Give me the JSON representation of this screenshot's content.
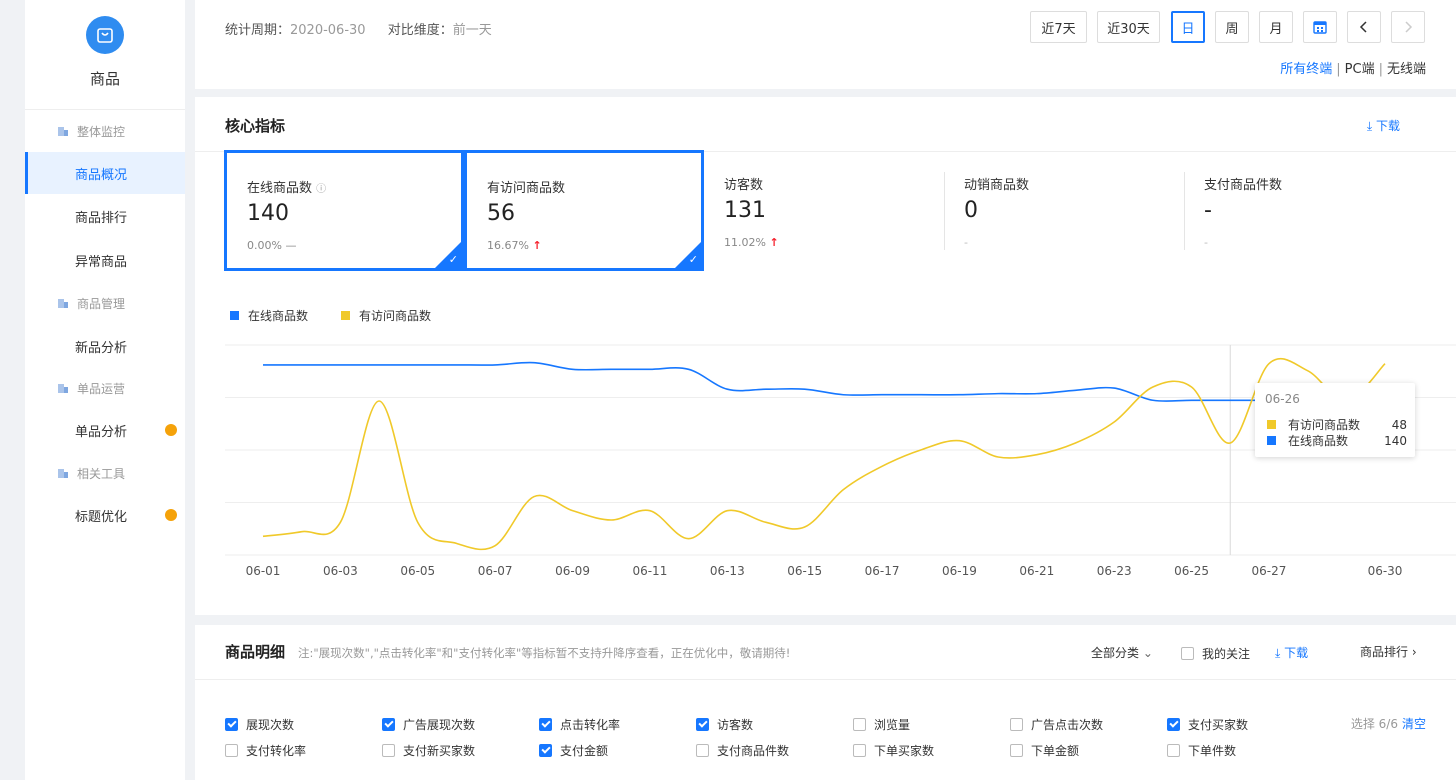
{
  "sidebar": {
    "title": "商品",
    "groups": [
      "整体监控",
      "商品管理",
      "单品运营",
      "相关工具"
    ],
    "items": [
      "商品概况",
      "商品排行",
      "异常商品",
      "新品分析",
      "单品分析",
      "标题优化"
    ]
  },
  "topbar": {
    "period_label": "统计周期：",
    "period_value": "2020-06-30",
    "compare_label": "对比维度：",
    "compare_value": "前一天",
    "buttons": [
      "近7天",
      "近30天",
      "日",
      "周",
      "月"
    ],
    "terminals": [
      "所有终端",
      "PC端",
      "无线端"
    ],
    "separator": "|"
  },
  "core": {
    "title": "核心指标",
    "download": "下载",
    "cards": [
      {
        "name": "在线商品数",
        "value": "140",
        "change": "0.00%",
        "trend": "—",
        "selected": true
      },
      {
        "name": "有访问商品数",
        "value": "56",
        "change": "16.67%",
        "trend": "↑",
        "selected": true
      },
      {
        "name": "访客数",
        "value": "131",
        "change": "11.02%",
        "trend": "↑",
        "selected": false
      },
      {
        "name": "动销商品数",
        "value": "0",
        "change": "-",
        "trend": "",
        "selected": false
      },
      {
        "name": "支付商品件数",
        "value": "-",
        "change": "-",
        "trend": "",
        "selected": false
      }
    ]
  },
  "chart_data": {
    "type": "line",
    "x": [
      "06-01",
      "06-02",
      "06-03",
      "06-04",
      "06-05",
      "06-06",
      "06-07",
      "06-08",
      "06-09",
      "06-10",
      "06-11",
      "06-12",
      "06-13",
      "06-14",
      "06-15",
      "06-16",
      "06-17",
      "06-18",
      "06-19",
      "06-20",
      "06-21",
      "06-22",
      "06-23",
      "06-24",
      "06-25",
      "06-26",
      "06-27",
      "06-28",
      "06-29",
      "06-30"
    ],
    "tick_labels": [
      "06-01",
      "06-03",
      "06-05",
      "06-07",
      "06-09",
      "06-11",
      "06-13",
      "06-15",
      "06-17",
      "06-19",
      "06-21",
      "06-23",
      "06-25",
      "06-27",
      "06-30"
    ],
    "series": [
      {
        "name": "在线商品数",
        "color": "#1677ff",
        "values": [
          172,
          172,
          172,
          172,
          172,
          172,
          172,
          174,
          168,
          168,
          168,
          168,
          150,
          150,
          150,
          145,
          145,
          145,
          145,
          146,
          146,
          149,
          151,
          140,
          140,
          140,
          140,
          140,
          140,
          140
        ]
      },
      {
        "name": "有访问商品数",
        "color": "#f0c92a",
        "values": [
          8,
          10,
          14,
          66,
          14,
          5,
          4,
          25,
          19,
          15,
          19,
          7,
          19,
          14,
          12,
          28,
          38,
          45,
          49,
          42,
          43,
          48,
          57,
          72,
          72,
          48,
          82,
          79,
          66,
          82
        ]
      }
    ],
    "tooltip": {
      "date": "06-26",
      "rows": [
        {
          "name": "有访问商品数",
          "value": "48"
        },
        {
          "name": "在线商品数",
          "value": "140"
        }
      ]
    }
  },
  "detail": {
    "title": "商品明细",
    "note": "注:\"展现次数\",\"点击转化率\"和\"支付转化率\"等指标暂不支持升降序查看，正在优化中，敬请期待!",
    "category": "全部分类",
    "my_follow": "我的关注",
    "download": "下载",
    "ranking": "商品排行",
    "options": [
      {
        "label": "展现次数",
        "checked": true
      },
      {
        "label": "广告展现次数",
        "checked": true
      },
      {
        "label": "点击转化率",
        "checked": true
      },
      {
        "label": "访客数",
        "checked": true
      },
      {
        "label": "浏览量",
        "checked": false
      },
      {
        "label": "广告点击次数",
        "checked": false
      },
      {
        "label": "支付买家数",
        "checked": true
      },
      {
        "label": "支付转化率",
        "checked": false
      },
      {
        "label": "支付新买家数",
        "checked": false
      },
      {
        "label": "支付金额",
        "checked": true
      },
      {
        "label": "支付商品件数",
        "checked": false
      },
      {
        "label": "下单买家数",
        "checked": false
      },
      {
        "label": "下单金额",
        "checked": false
      },
      {
        "label": "下单件数",
        "checked": false
      }
    ],
    "select_count": "选择 6/6",
    "clear": "清空"
  }
}
